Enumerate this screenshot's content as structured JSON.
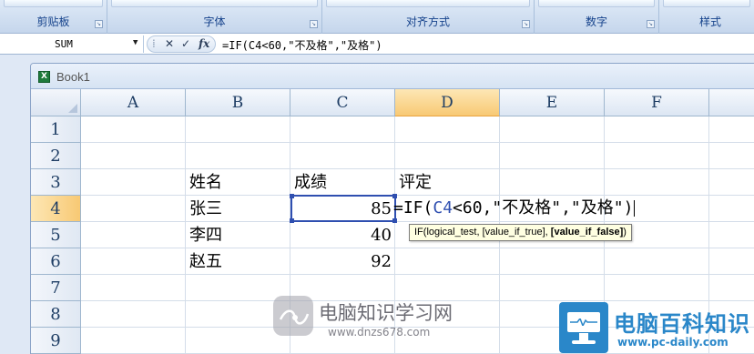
{
  "ribbon": {
    "groups": [
      "剪贴板",
      "字体",
      "对齐方式",
      "数字",
      "样式"
    ]
  },
  "formula_bar": {
    "name_box": "SUM",
    "cancel_symbol": "✕",
    "enter_symbol": "✓",
    "fx_symbol": "fx",
    "formula": "=IF(C4<60,\"不及格\",\"及格\")"
  },
  "window": {
    "title": "Book1"
  },
  "sheet": {
    "columns": [
      "A",
      "B",
      "C",
      "D",
      "E",
      "F"
    ],
    "rows": [
      "1",
      "2",
      "3",
      "4",
      "5",
      "6",
      "7",
      "8",
      "9"
    ],
    "selected_column": "D",
    "selected_row": "4",
    "header_name": "姓名",
    "header_score": "成绩",
    "header_eval": "评定",
    "students": [
      {
        "name": "张三",
        "score": "85"
      },
      {
        "name": "李四",
        "score": "40"
      },
      {
        "name": "赵五",
        "score": "92"
      }
    ],
    "edit": {
      "prefix": "=IF(",
      "ref": "C4",
      "suffix": "<60,\"不及格\",\"及格\")"
    },
    "tooltip": {
      "plain": "IF(logical_test, [value_if_true], ",
      "bold": "[value_if_false]",
      "end": ")"
    }
  },
  "watermarks": {
    "left_cn": "电脑知识学习网",
    "left_en": "www.dnzs678.com",
    "right_cn": "电脑百科知识",
    "right_en": "www.pc-daily.com"
  }
}
